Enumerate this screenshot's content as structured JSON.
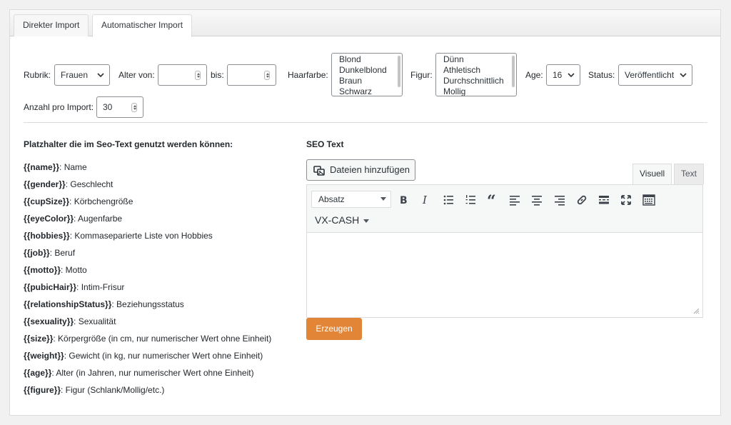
{
  "tabs": [
    {
      "label": "Direkter Import",
      "active": false
    },
    {
      "label": "Automatischer Import",
      "active": true
    }
  ],
  "form": {
    "rubrik": {
      "label": "Rubrik:",
      "value": "Frauen"
    },
    "alter_von": {
      "label": "Alter von:",
      "value": ""
    },
    "bis": {
      "label": "bis:",
      "value": ""
    },
    "haarfarbe": {
      "label": "Haarfarbe:",
      "options": [
        "Blond",
        "Dunkelblond",
        "Braun",
        "Schwarz"
      ]
    },
    "figur": {
      "label": "Figur:",
      "options": [
        "Dünn",
        "Athletisch",
        "Durchschnittlich",
        "Mollig"
      ]
    },
    "age": {
      "label": "Age:",
      "value": "16"
    },
    "status": {
      "label": "Status:",
      "value": "Veröffentlicht"
    },
    "anzahl": {
      "label": "Anzahl pro Import:",
      "value": "30"
    }
  },
  "placeholders": {
    "title": "Platzhalter die im Seo-Text genutzt werden können:",
    "items": [
      {
        "key": "{{name}}",
        "desc": ": Name"
      },
      {
        "key": "{{gender}}",
        "desc": ": Geschlecht"
      },
      {
        "key": "{{cupSize}}",
        "desc": ": Körbchengröße"
      },
      {
        "key": "{{eyeColor}}",
        "desc": ": Augenfarbe"
      },
      {
        "key": "{{hobbies}}",
        "desc": ": Kommaseparierte Liste von Hobbies"
      },
      {
        "key": "{{job}}",
        "desc": ": Beruf"
      },
      {
        "key": "{{motto}}",
        "desc": ": Motto"
      },
      {
        "key": "{{pubicHair}}",
        "desc": ": Intim-Frisur"
      },
      {
        "key": "{{relationshipStatus}}",
        "desc": ": Beziehungsstatus"
      },
      {
        "key": "{{sexuality}}",
        "desc": ": Sexualität"
      },
      {
        "key": "{{size}}",
        "desc": ": Körpergröße (in cm, nur numerischer Wert ohne Einheit)"
      },
      {
        "key": "{{weight}}",
        "desc": ": Gewicht (in kg, nur numerischer Wert ohne Einheit)"
      },
      {
        "key": "{{age}}",
        "desc": ": Alter (in Jahren, nur numerischer Wert ohne Einheit)"
      },
      {
        "key": "{{figure}}",
        "desc": ": Figur (Schlank/Mollig/etc.)"
      }
    ]
  },
  "seo": {
    "title": "SEO Text",
    "media_button": "Dateien hinzufügen",
    "tab_visual": "Visuell",
    "tab_text": "Text",
    "format_select": "Absatz",
    "custom_menu": "VX-CASH",
    "content": "",
    "toolbar_icons": [
      "bold-icon",
      "italic-icon",
      "bullet-list-icon",
      "numbered-list-icon",
      "blockquote-icon",
      "align-left-icon",
      "align-center-icon",
      "align-right-icon",
      "link-icon",
      "read-more-icon",
      "fullscreen-icon",
      "toolbar-toggle-icon"
    ]
  },
  "generate_button": "Erzeugen",
  "colors": {
    "accent": "#e38536",
    "border": "#8c8f94"
  }
}
